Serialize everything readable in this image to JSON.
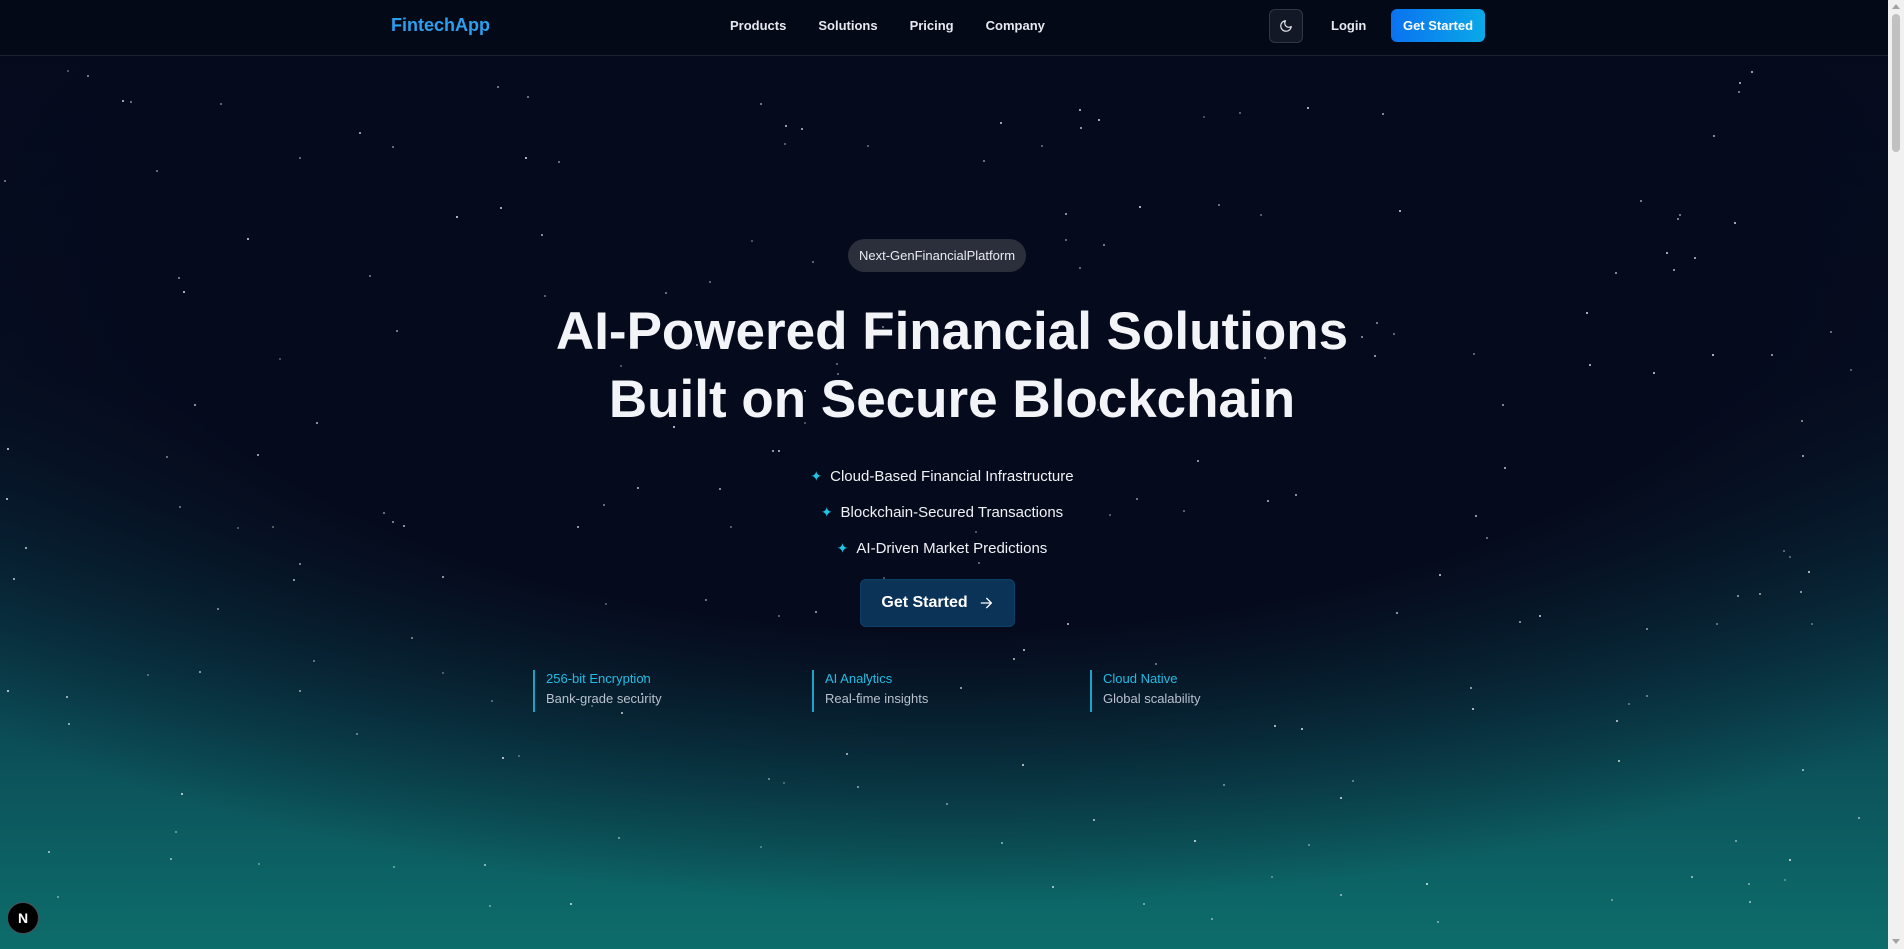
{
  "nav": {
    "logo": "FintechApp",
    "links": [
      "Products",
      "Solutions",
      "Pricing",
      "Company"
    ],
    "theme_icon": "moon-icon",
    "login": "Login",
    "cta": "Get Started"
  },
  "hero": {
    "badge": "Next-GenFinancialPlatform",
    "title_line1": "AI-Powered Financial Solutions",
    "title_line2": "Built on Secure Blockchain",
    "features": [
      "Cloud-Based Financial Infrastructure",
      "Blockchain-Secured Transactions",
      "AI-Driven Market Predictions"
    ],
    "feature_icon": "sparkle-icon",
    "cta": "Get Started",
    "cta_icon": "arrow-right-icon"
  },
  "stats": [
    {
      "title": "256-bit Encryption",
      "subtitle": "Bank-grade security"
    },
    {
      "title": "AI Analytics",
      "subtitle": "Real-time insights"
    },
    {
      "title": "Cloud Native",
      "subtitle": "Global scalability"
    }
  ],
  "dev_badge": "N",
  "colors": {
    "background": "#050a1c",
    "teal_glow": "#0d6d6b",
    "accent": "#1fc5e8",
    "logo": "#2b9ff0",
    "button_gradient_start": "#0a72f0",
    "button_gradient_end": "#0aa9e8",
    "hero_button": "#0b3357"
  }
}
